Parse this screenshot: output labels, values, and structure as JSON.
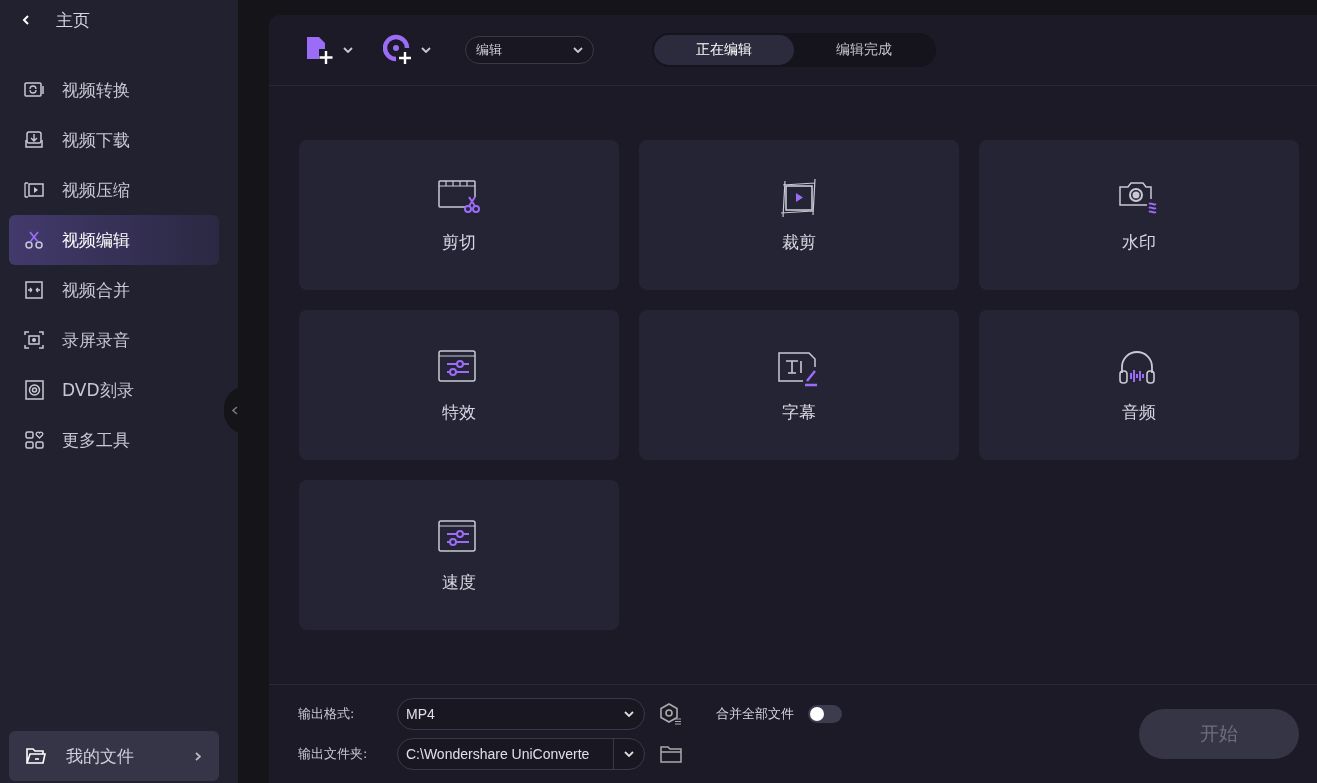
{
  "sidebar": {
    "back": {
      "label": "主页"
    },
    "items": [
      {
        "label": "视频转换",
        "selected": false
      },
      {
        "label": "视频下载",
        "selected": false
      },
      {
        "label": "视频压缩",
        "selected": false
      },
      {
        "label": "视频编辑",
        "selected": true
      },
      {
        "label": "视频合并",
        "selected": false
      },
      {
        "label": "录屏录音",
        "selected": false
      },
      {
        "label": "DVD刻录",
        "selected": false
      },
      {
        "label": "更多工具",
        "selected": false
      }
    ],
    "footer": {
      "label": "我的文件"
    }
  },
  "toolbar": {
    "mode_select": {
      "value": "编辑"
    },
    "tabs": [
      {
        "label": "正在编辑",
        "selected": true
      },
      {
        "label": "编辑完成",
        "selected": false
      }
    ]
  },
  "tools": [
    {
      "label": "剪切"
    },
    {
      "label": "裁剪"
    },
    {
      "label": "水印"
    },
    {
      "label": "特效"
    },
    {
      "label": "字幕"
    },
    {
      "label": "音频"
    },
    {
      "label": "速度"
    }
  ],
  "output": {
    "format_label": "输出格式:",
    "format_value": "MP4",
    "merge_label": "合并全部文件",
    "merge_on": false,
    "folder_label": "输出文件夹:",
    "folder_value": "C:\\Wondershare UniConverte",
    "start": {
      "label": "开始",
      "disabled": true
    }
  }
}
